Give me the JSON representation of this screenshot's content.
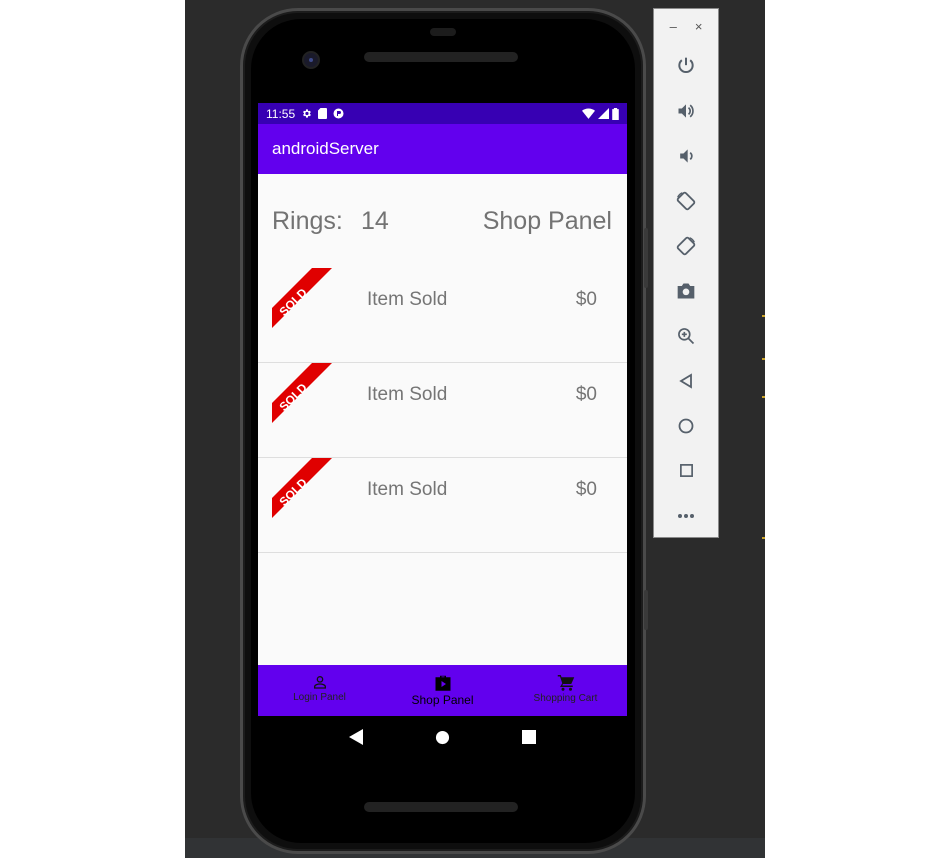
{
  "status_bar": {
    "time": "11:55",
    "left_icons": [
      "gear-icon",
      "sd-card-icon",
      "app-notification-icon"
    ],
    "right_icons": [
      "wifi-icon",
      "cell-signal-icon",
      "battery-icon"
    ]
  },
  "app_bar": {
    "title": "androidServer"
  },
  "header": {
    "rings_label": "Rings:",
    "rings_value": "14",
    "panel_title": "Shop Panel"
  },
  "items": [
    {
      "badge": "SOLD",
      "name": "Item Sold",
      "price": "$0"
    },
    {
      "badge": "SOLD",
      "name": "Item Sold",
      "price": "$0"
    },
    {
      "badge": "SOLD",
      "name": "Item Sold",
      "price": "$0"
    }
  ],
  "bottom_nav": {
    "items": [
      {
        "label": "Login Panel",
        "icon": "person-icon",
        "active": false
      },
      {
        "label": "Shop Panel",
        "icon": "shopping-bag-icon",
        "active": true
      },
      {
        "label": "Shopping Cart",
        "icon": "cart-icon",
        "active": false
      }
    ]
  },
  "system_nav": [
    "back-icon",
    "home-icon",
    "recents-icon"
  ],
  "emulator_toolbar": {
    "window_controls": {
      "minimize": "–",
      "close": "×"
    },
    "buttons": [
      "power-icon",
      "volume-up-icon",
      "volume-down-icon",
      "rotate-left-icon",
      "rotate-right-icon",
      "camera-icon",
      "zoom-icon",
      "back-icon",
      "home-icon",
      "overview-icon",
      "more-icon"
    ]
  },
  "colors": {
    "status_bar": "#3700b3",
    "app_bar": "#6200ee",
    "bottom_nav": "#6200ee",
    "sold_ribbon": "#e00000"
  }
}
